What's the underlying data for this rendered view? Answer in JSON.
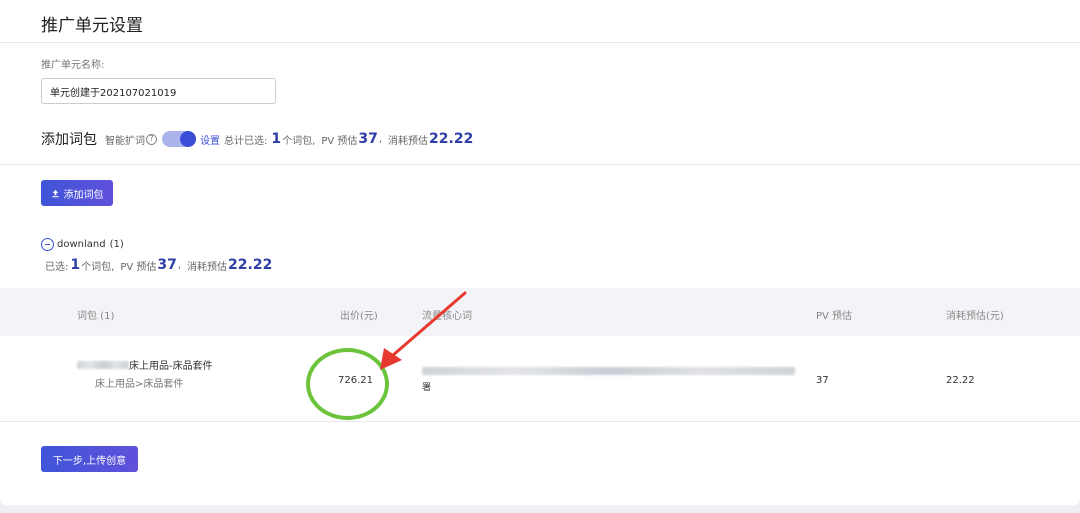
{
  "page": {
    "title": "推广单元设置"
  },
  "unit_name": {
    "label": "推广单元名称:",
    "value": "单元创建于202107021019"
  },
  "keyword_package": {
    "title": "添加词包",
    "smart_expand_label": "智能扩词",
    "help_glyph": "?",
    "toggle_on": true,
    "settings_link": "设置",
    "total_selected_label": "总计已选:",
    "count": "1",
    "count_unit": "个词包,",
    "pv_label": "PV 预估",
    "pv_value": "37",
    "cost_separator": ",",
    "cost_label": "消耗预估",
    "cost_value": "22.22"
  },
  "add_button": {
    "label": "添加词包",
    "icon": "upload-icon"
  },
  "group": {
    "icon": "collapse-minus-icon",
    "name": "downland",
    "count": "(1)",
    "selected_label": "已选:",
    "selected_count": "1",
    "selected_unit": "个词包,",
    "pv_label": "PV 预估",
    "pv_value": "37",
    "cost_separator": ",",
    "cost_label": "消耗预估",
    "cost_value": "22.22"
  },
  "table": {
    "headers": {
      "package": "词包 (1)",
      "bid": "出价(元)",
      "core_words": "流量核心词",
      "pv": "PV 预估",
      "cost": "消耗预估(元)"
    },
    "rows": [
      {
        "name_suffix": "床上用品-床品套件",
        "category": "床上用品>床品套件",
        "bid": "726.21",
        "core_words_tail": "署",
        "pv": "37",
        "cost": "22.22"
      }
    ]
  },
  "next_button": {
    "label": "下一步,上传创意"
  },
  "annotation": {
    "circle_color": "#6cc43c",
    "arrow_color": "#e8392f"
  },
  "colors": {
    "accent": "#3b4fd6",
    "accent_dark": "#2e3ea8",
    "toggle_track": "#aab3ec"
  }
}
